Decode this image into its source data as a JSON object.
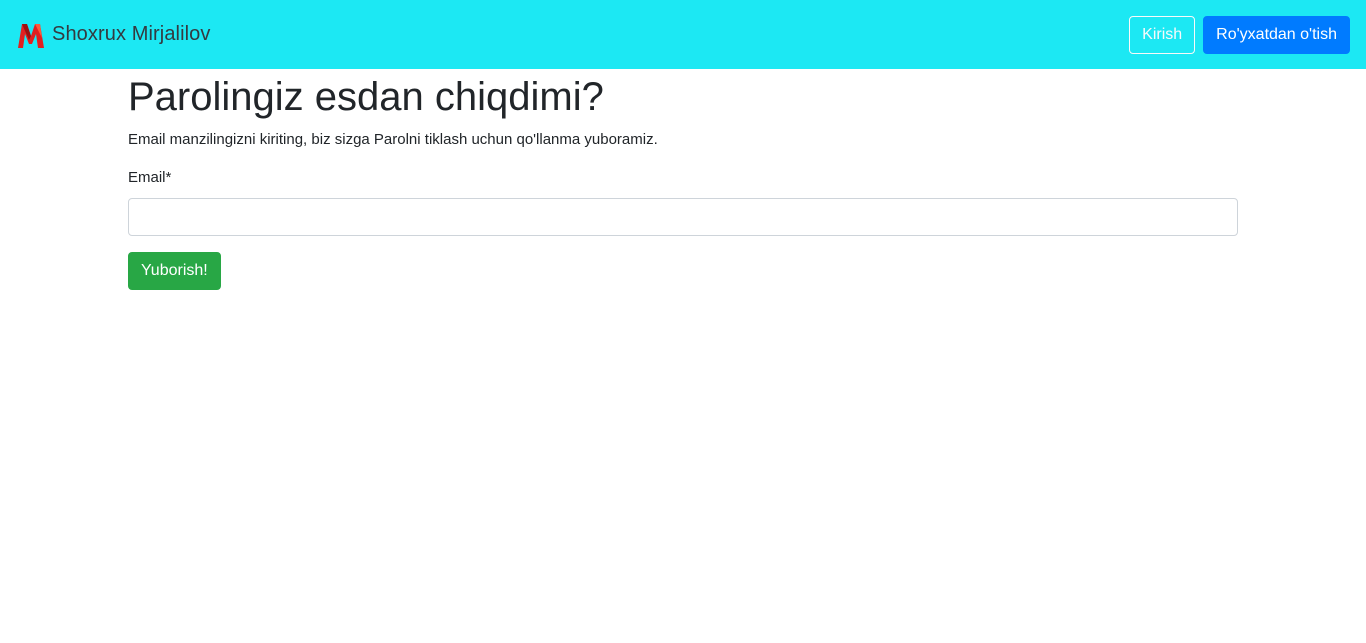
{
  "navbar": {
    "brand_name": "Shoxrux Mirjalilov",
    "logo_icon": "m-letter-logo",
    "background": "#1ce8f3",
    "login_label": "Kirish",
    "register_label": "Ro'yxatdan o'tish"
  },
  "main": {
    "title": "Parolingiz esdan chiqdimi?",
    "description": "Email manzilingizni kiriting, biz sizga Parolni tiklash uchun qo'llanma yuboramiz.",
    "email_label": "Email*",
    "email_value": "",
    "submit_label": "Yuborish!"
  },
  "colors": {
    "primary": "#007bff",
    "success": "#28a745",
    "logo": "#e02020"
  }
}
